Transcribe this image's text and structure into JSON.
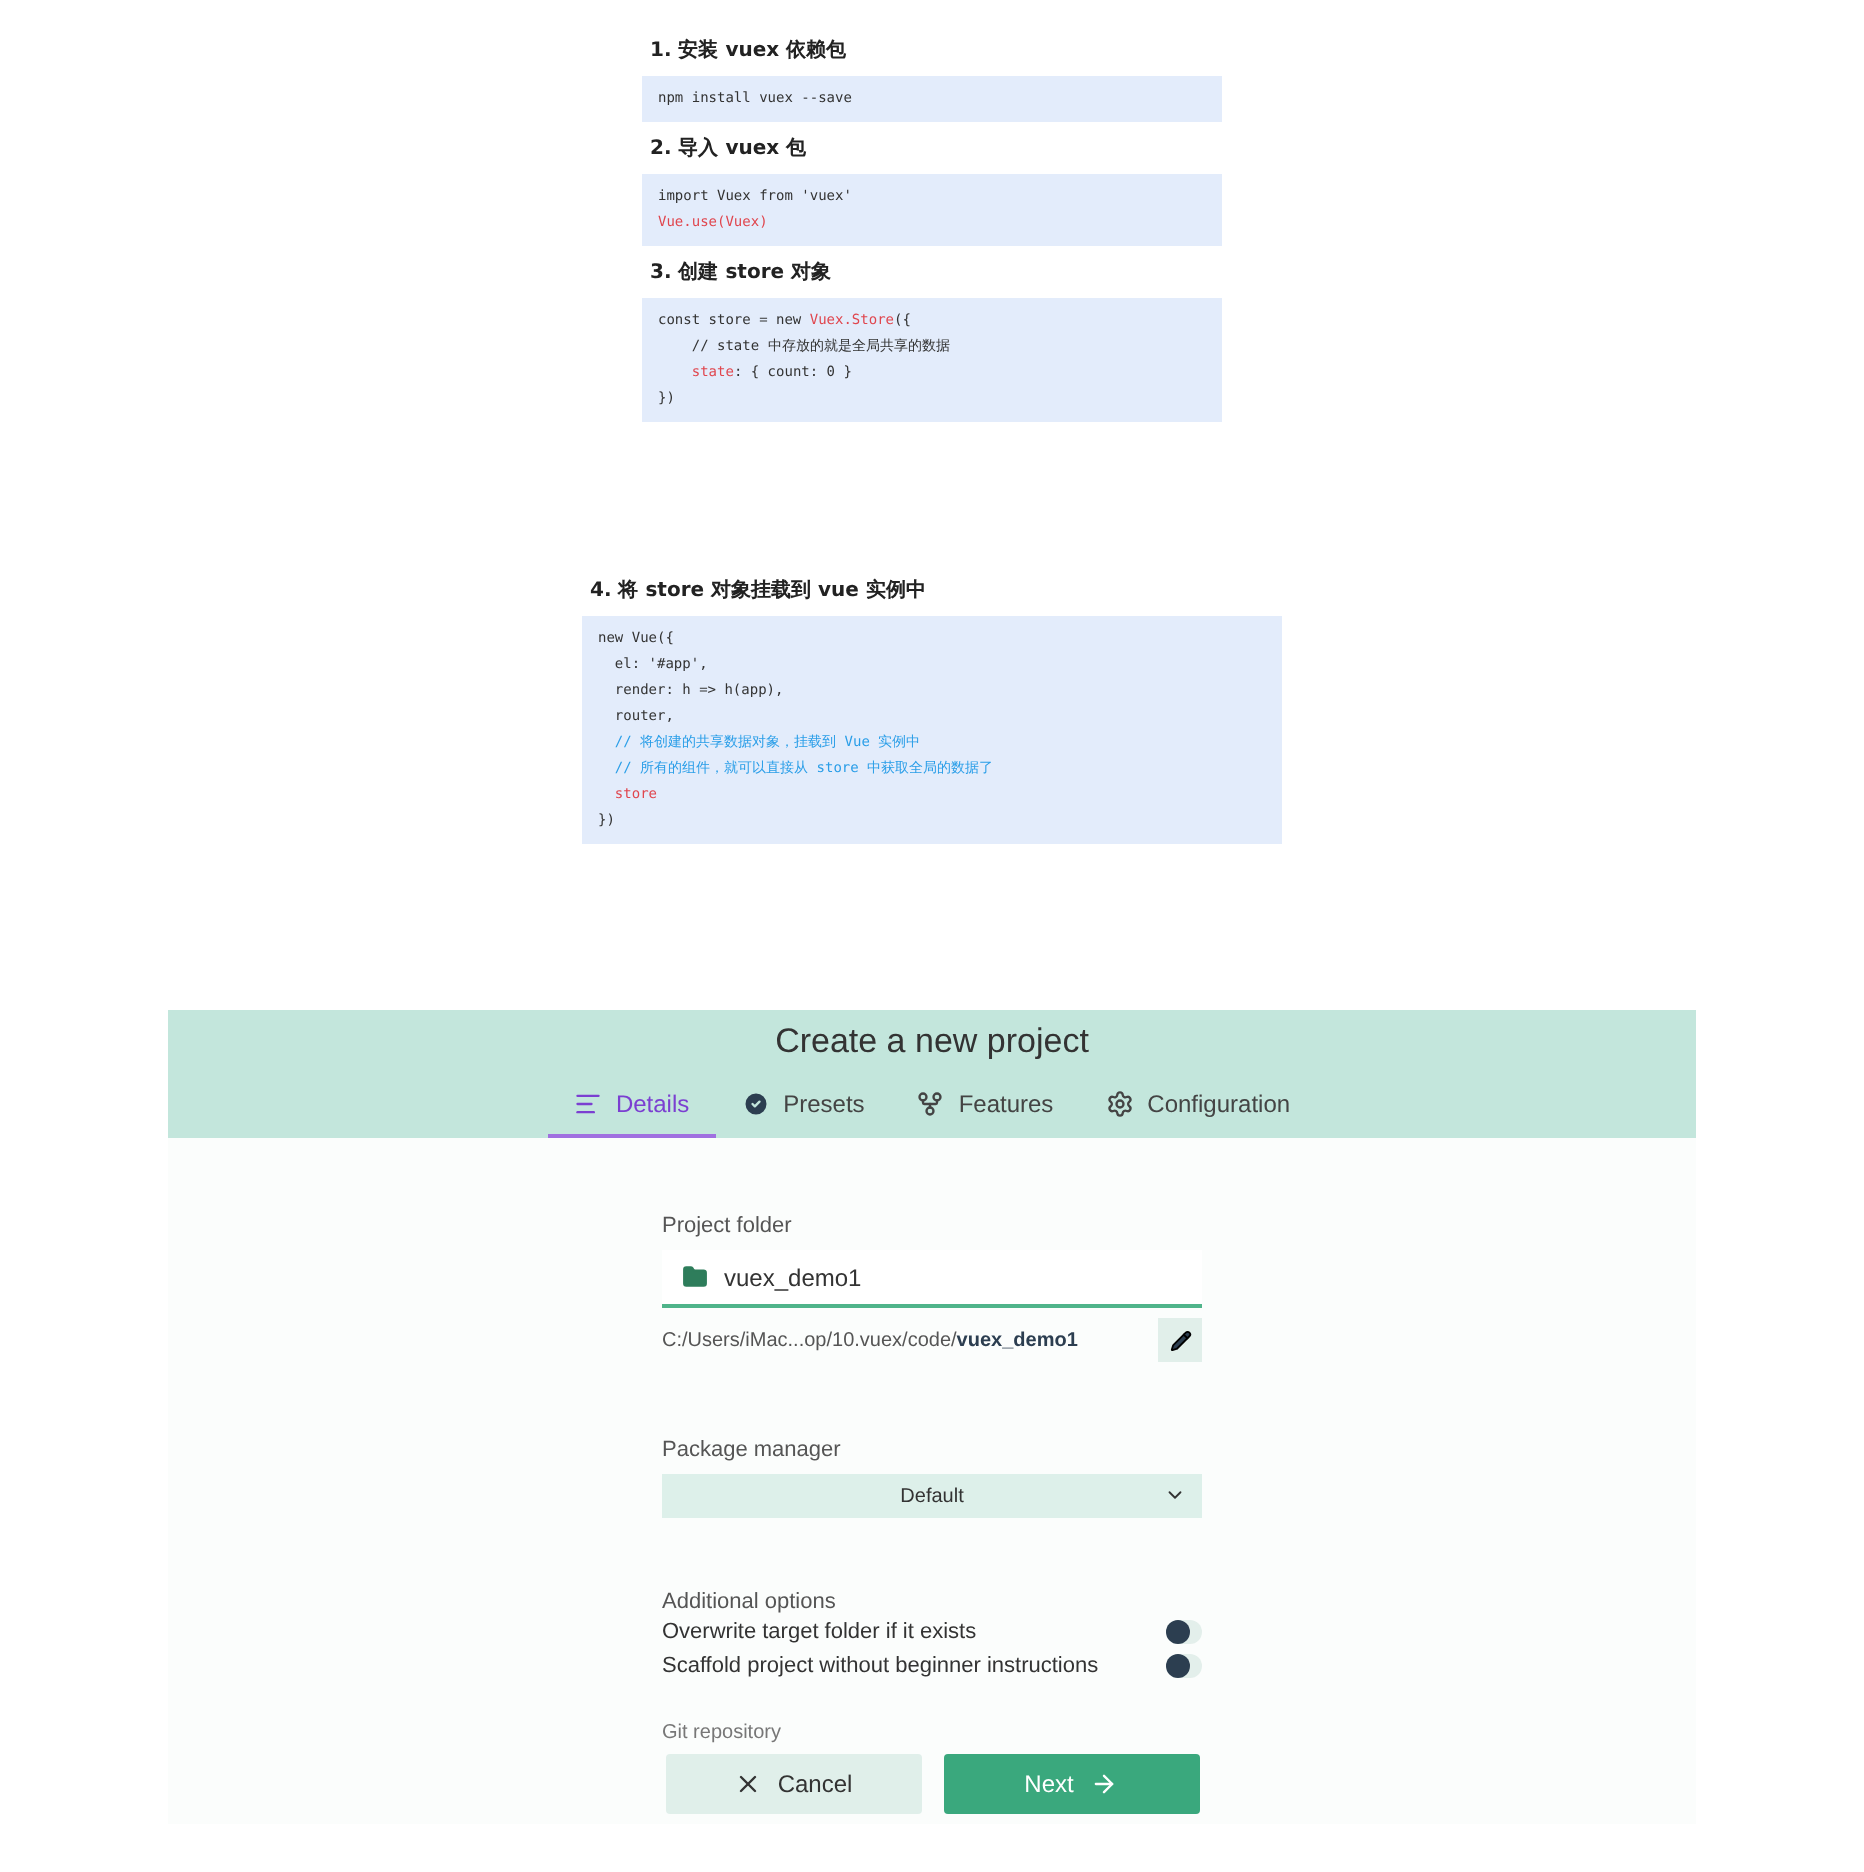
{
  "slides": [
    {
      "sections": [
        {
          "heading": "1. 安装 vuex 依赖包",
          "code": [
            [
              {
                "text": "npm install vuex --save",
                "kind": "plain"
              }
            ]
          ]
        },
        {
          "heading": "2. 导入 vuex 包",
          "code": [
            [
              {
                "text": "import Vuex from 'vuex'",
                "kind": "plain"
              }
            ],
            [
              {
                "text": "Vue.use(Vuex)",
                "kind": "keyword"
              }
            ]
          ]
        },
        {
          "heading": "3. 创建 store 对象",
          "code": [
            [
              {
                "text": "const store = new ",
                "kind": "plain"
              },
              {
                "text": "Vuex.Store",
                "kind": "keyword"
              },
              {
                "text": "({",
                "kind": "plain"
              }
            ],
            [
              {
                "text": "    // state 中存放的就是全局共享的数据",
                "kind": "plain"
              }
            ],
            [
              {
                "text": "    state",
                "kind": "keyword"
              },
              {
                "text": ": { count: 0 }",
                "kind": "plain"
              }
            ],
            [
              {
                "text": "})",
                "kind": "plain"
              }
            ]
          ]
        }
      ]
    },
    {
      "sections": [
        {
          "heading": "4. 将 store 对象挂载到 vue 实例中",
          "code": [
            [
              {
                "text": "new Vue({",
                "kind": "plain"
              }
            ],
            [
              {
                "text": "  el: '#app',",
                "kind": "plain"
              }
            ],
            [
              {
                "text": "  render: h => h(app),",
                "kind": "plain"
              }
            ],
            [
              {
                "text": "  router,",
                "kind": "plain"
              }
            ],
            [
              {
                "text": "  // 将创建的共享数据对象，挂载到 Vue 实例中",
                "kind": "comment"
              }
            ],
            [
              {
                "text": "  // 所有的组件，就可以直接从 store 中获取全局的数据了",
                "kind": "comment"
              }
            ],
            [
              {
                "text": "  store",
                "kind": "keyword"
              }
            ],
            [
              {
                "text": "})",
                "kind": "plain"
              }
            ]
          ]
        }
      ]
    }
  ],
  "app": {
    "title": "Create a new project",
    "tabs": [
      {
        "label": "Details",
        "selected": true
      },
      {
        "label": "Presets",
        "selected": false
      },
      {
        "label": "Features",
        "selected": false
      },
      {
        "label": "Configuration",
        "selected": false
      }
    ],
    "project_folder": {
      "label": "Project folder",
      "value": "vuex_demo1",
      "path": "C:/Users/iMac...op/10.vuex/code/**vuex_demo1**"
    },
    "package_manager": {
      "label": "Package manager",
      "value": "Default"
    },
    "additional_options": {
      "label": "Additional options",
      "options": [
        {
          "label": "Overwrite target folder if it exists",
          "on": false
        },
        {
          "label": "Scaffold project without beginner instructions",
          "on": false
        }
      ]
    },
    "git_label": "Git repository",
    "buttons": {
      "cancel": "Cancel",
      "next": "Next"
    }
  }
}
